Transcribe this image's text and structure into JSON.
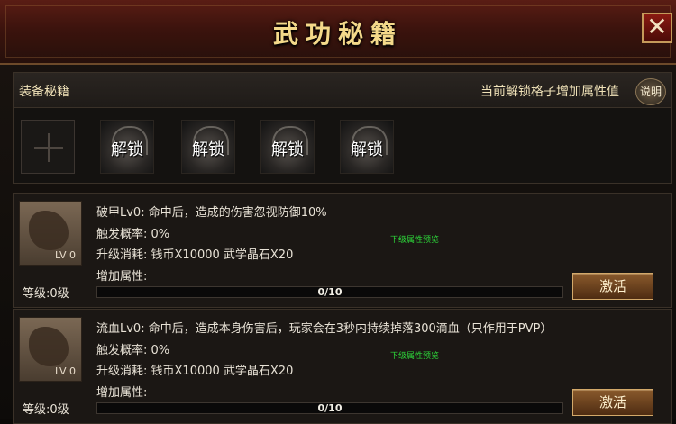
{
  "window": {
    "title": "武功秘籍",
    "close_label": "✕"
  },
  "equip_panel": {
    "title": "装备秘籍",
    "hint": "当前解锁格子增加属性值",
    "help_label": "说明",
    "lock_label": "解锁"
  },
  "skills": [
    {
      "line1": "破甲Lv0: 命中后，造成的伤害忽视防御10%",
      "trigger": "触发概率: 0%",
      "cost": "升级消耗: 钱币X10000 武学晶石X20",
      "bonus": "增加属性:",
      "preview": "下级属性预览",
      "icon_lv": "LV 0",
      "level": "等级:0级",
      "progress_text": "0/10",
      "progress_value": 0,
      "progress_max": 10,
      "button": "激活"
    },
    {
      "line1": "流血Lv0: 命中后，造成本身伤害后，玩家会在3秒内持续掉落300滴血（只作用于PVP）",
      "trigger": "触发概率: 0%",
      "cost": "升级消耗: 钱币X10000 武学晶石X20",
      "bonus": "增加属性:",
      "preview": "下级属性预览",
      "icon_lv": "LV 0",
      "level": "等级:0级",
      "progress_text": "0/10",
      "progress_value": 0,
      "progress_max": 10,
      "button": "激活"
    }
  ]
}
